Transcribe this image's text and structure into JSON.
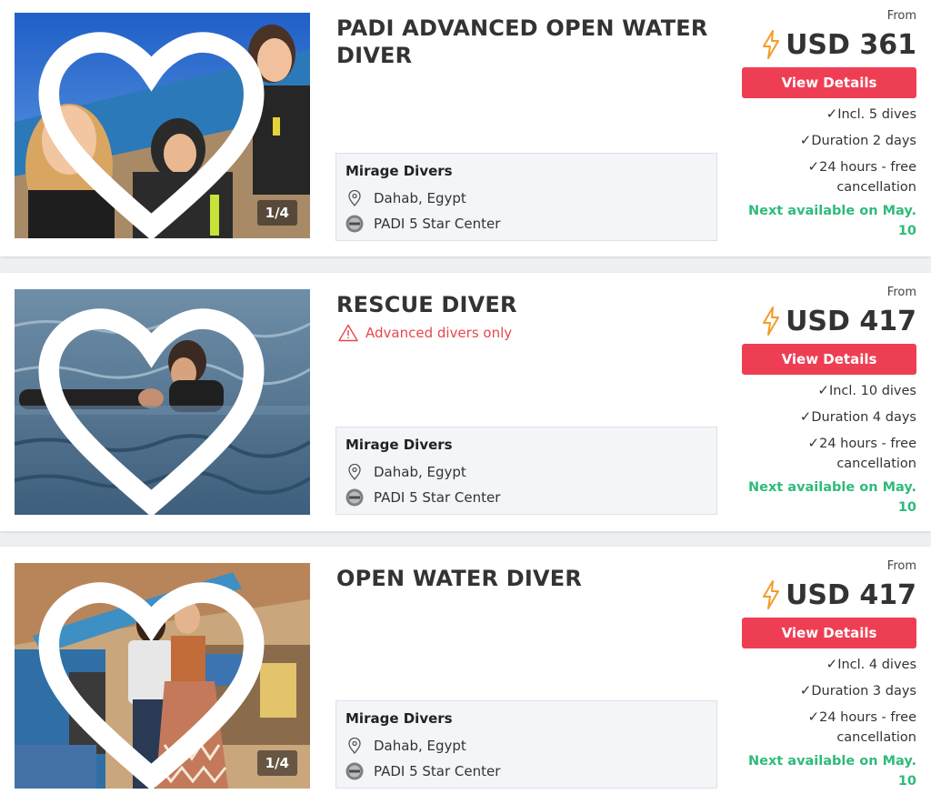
{
  "courses": [
    {
      "title": "PADI ADVANCED OPEN WATER DIVER",
      "warning": "",
      "image_counter": "1/4",
      "operator": {
        "name": "Mirage Divers",
        "location": "Dahab, Egypt",
        "rating": "PADI 5 Star Center"
      },
      "from_label": "From",
      "price": "USD 361",
      "button_label": "View Details",
      "features": [
        "Incl. 5 dives",
        "Duration 2 days",
        "24 hours - free cancellation"
      ],
      "availability": "Next available on May. 10"
    },
    {
      "title": "RESCUE DIVER",
      "warning": "Advanced divers only",
      "image_counter": "",
      "operator": {
        "name": "Mirage Divers",
        "location": "Dahab, Egypt",
        "rating": "PADI 5 Star Center"
      },
      "from_label": "From",
      "price": "USD 417",
      "button_label": "View Details",
      "features": [
        "Incl. 10 dives",
        "Duration 4 days",
        "24 hours - free cancellation"
      ],
      "availability": "Next available on May. 10"
    },
    {
      "title": "OPEN WATER DIVER",
      "warning": "",
      "image_counter": "1/4",
      "operator": {
        "name": "Mirage Divers",
        "location": "Dahab, Egypt",
        "rating": "PADI 5 Star Center"
      },
      "from_label": "From",
      "price": "USD 417",
      "button_label": "View Details",
      "features": [
        "Incl. 4 dives",
        "Duration 3 days",
        "24 hours - free cancellation"
      ],
      "availability": "Next available on May. 10"
    }
  ],
  "colors": {
    "accent": "#ee3e54",
    "available": "#2fbb7a",
    "warning": "#e5484d",
    "bolt": "#f39c28"
  },
  "icons": [
    "heart-icon",
    "location-pin-icon",
    "padi-badge-icon",
    "lightning-icon",
    "check-icon",
    "warning-triangle-icon"
  ]
}
